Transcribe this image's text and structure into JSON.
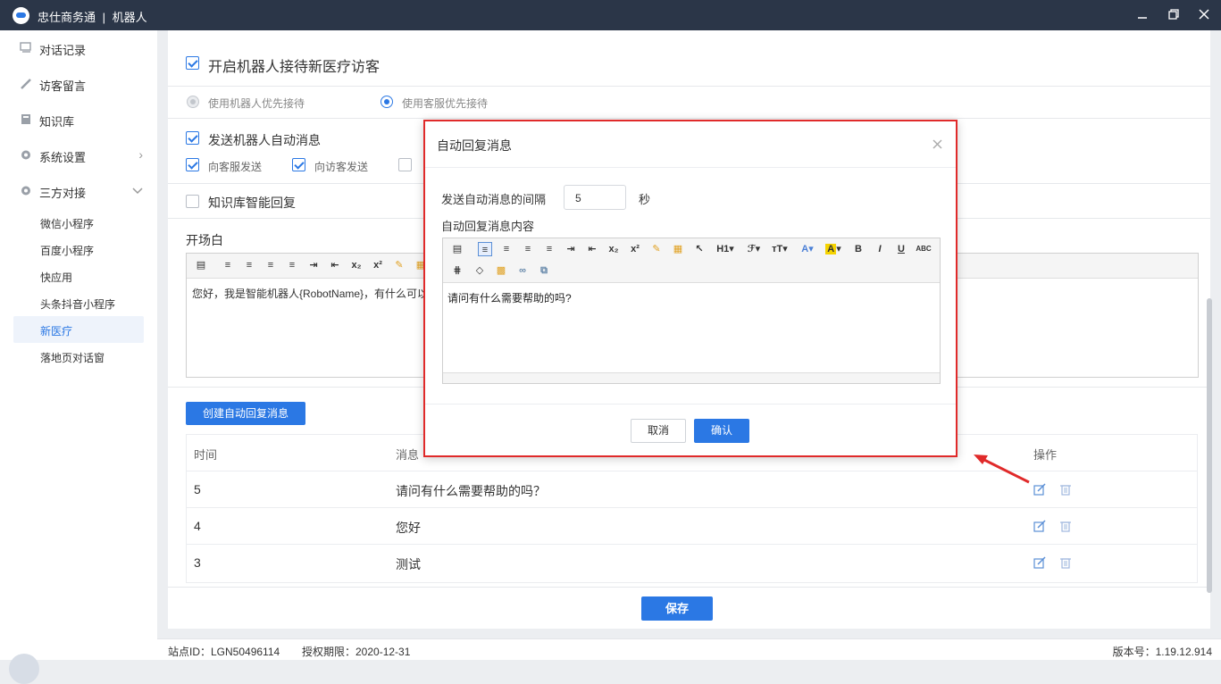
{
  "titlebar": {
    "app": "忠仕商务通",
    "sep": "|",
    "module": "机器人",
    "min_icon": "minimize-icon",
    "max_icon": "maximize-icon",
    "close_icon": "close-icon"
  },
  "sidebar": {
    "items": [
      {
        "label": "对话记录",
        "icon": "chat-record-icon"
      },
      {
        "label": "访客留言",
        "icon": "pencil-icon"
      },
      {
        "label": "知识库",
        "icon": "book-icon"
      },
      {
        "label": "系统设置",
        "icon": "gear-icon"
      },
      {
        "label": "三方对接",
        "icon": "gear-icon"
      }
    ],
    "sub_items": [
      "微信小程序",
      "百度小程序",
      "快应用",
      "头条抖音小程序",
      "新医疗",
      "落地页对话窗"
    ],
    "active_sub": "新医疗"
  },
  "main": {
    "enable_robot": {
      "label": "开启机器人接待新医疗访客",
      "checked": true
    },
    "priority": {
      "option1": "使用机器人优先接待",
      "option2": "使用客服优先接待",
      "selected": "使用客服优先接待"
    },
    "send_auto": {
      "label": "发送机器人自动消息",
      "checked": true,
      "to_agent": "向客服发送",
      "to_visitor": "向访客发送"
    },
    "knowledge_reply": {
      "label": "知识库智能回复",
      "checked": false
    },
    "opening": {
      "label": "开场白",
      "content": "您好，我是智能机器人{RobotName}，有什么可以"
    },
    "create_button": "创建自动回复消息",
    "table": {
      "headers": [
        "时间",
        "消息",
        "操作"
      ],
      "rows": [
        {
          "time": "5",
          "message": "请问有什么需要帮助的吗？"
        },
        {
          "time": "4",
          "message": "您好"
        },
        {
          "time": "3",
          "message": "测试"
        }
      ]
    },
    "save_button": "保存"
  },
  "footer": {
    "site_id": "站点ID：LGN50496114",
    "license": "授权期限：2020-12-31",
    "version": "版本号：1.19.12.914"
  },
  "dialog": {
    "title": "自动回复消息",
    "interval_label": "发送自动消息的间隔",
    "interval_value": "5",
    "interval_unit": "秒",
    "content_label": "自动回复消息内容",
    "content": "请问有什么需要帮助的吗?",
    "cancel": "取消",
    "confirm": "确认",
    "toolbar": {
      "h1": "H1",
      "font_size": "тT",
      "font_color": "A",
      "bold": "B",
      "italic": "I",
      "underline": "U",
      "strike": "ABC"
    }
  },
  "colors": {
    "accent": "#2b78e4",
    "titlebar": "#2b3648",
    "highlight": "#e02a2a"
  }
}
